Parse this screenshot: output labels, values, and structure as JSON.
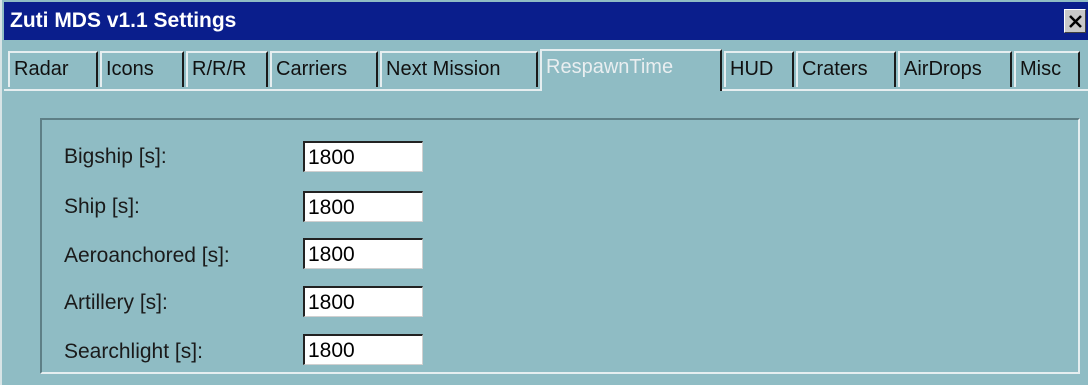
{
  "window": {
    "title": "Zuti MDS v1.1 Settings",
    "close_icon": "close-icon"
  },
  "tabs": [
    {
      "label": "Radar",
      "active": false
    },
    {
      "label": "Icons",
      "active": false
    },
    {
      "label": "R/R/R",
      "active": false
    },
    {
      "label": "Carriers",
      "active": false
    },
    {
      "label": "Next Mission",
      "active": false
    },
    {
      "label": "RespawnTime",
      "active": true
    },
    {
      "label": "HUD",
      "active": false
    },
    {
      "label": "Craters",
      "active": false
    },
    {
      "label": "AirDrops",
      "active": false
    },
    {
      "label": "Misc",
      "active": false
    }
  ],
  "fields": [
    {
      "label": "Bigship [s]:",
      "value": "1800"
    },
    {
      "label": "Ship [s]:",
      "value": "1800"
    },
    {
      "label": "Aeroanchored [s]:",
      "value": "1800"
    },
    {
      "label": "Artillery [s]:",
      "value": "1800"
    },
    {
      "label": "Searchlight [s]:",
      "value": "1800"
    }
  ],
  "colors": {
    "titlebar": "#0a1e8c",
    "background": "#8fbcc4",
    "active_tab_text": "#e9eef0"
  }
}
